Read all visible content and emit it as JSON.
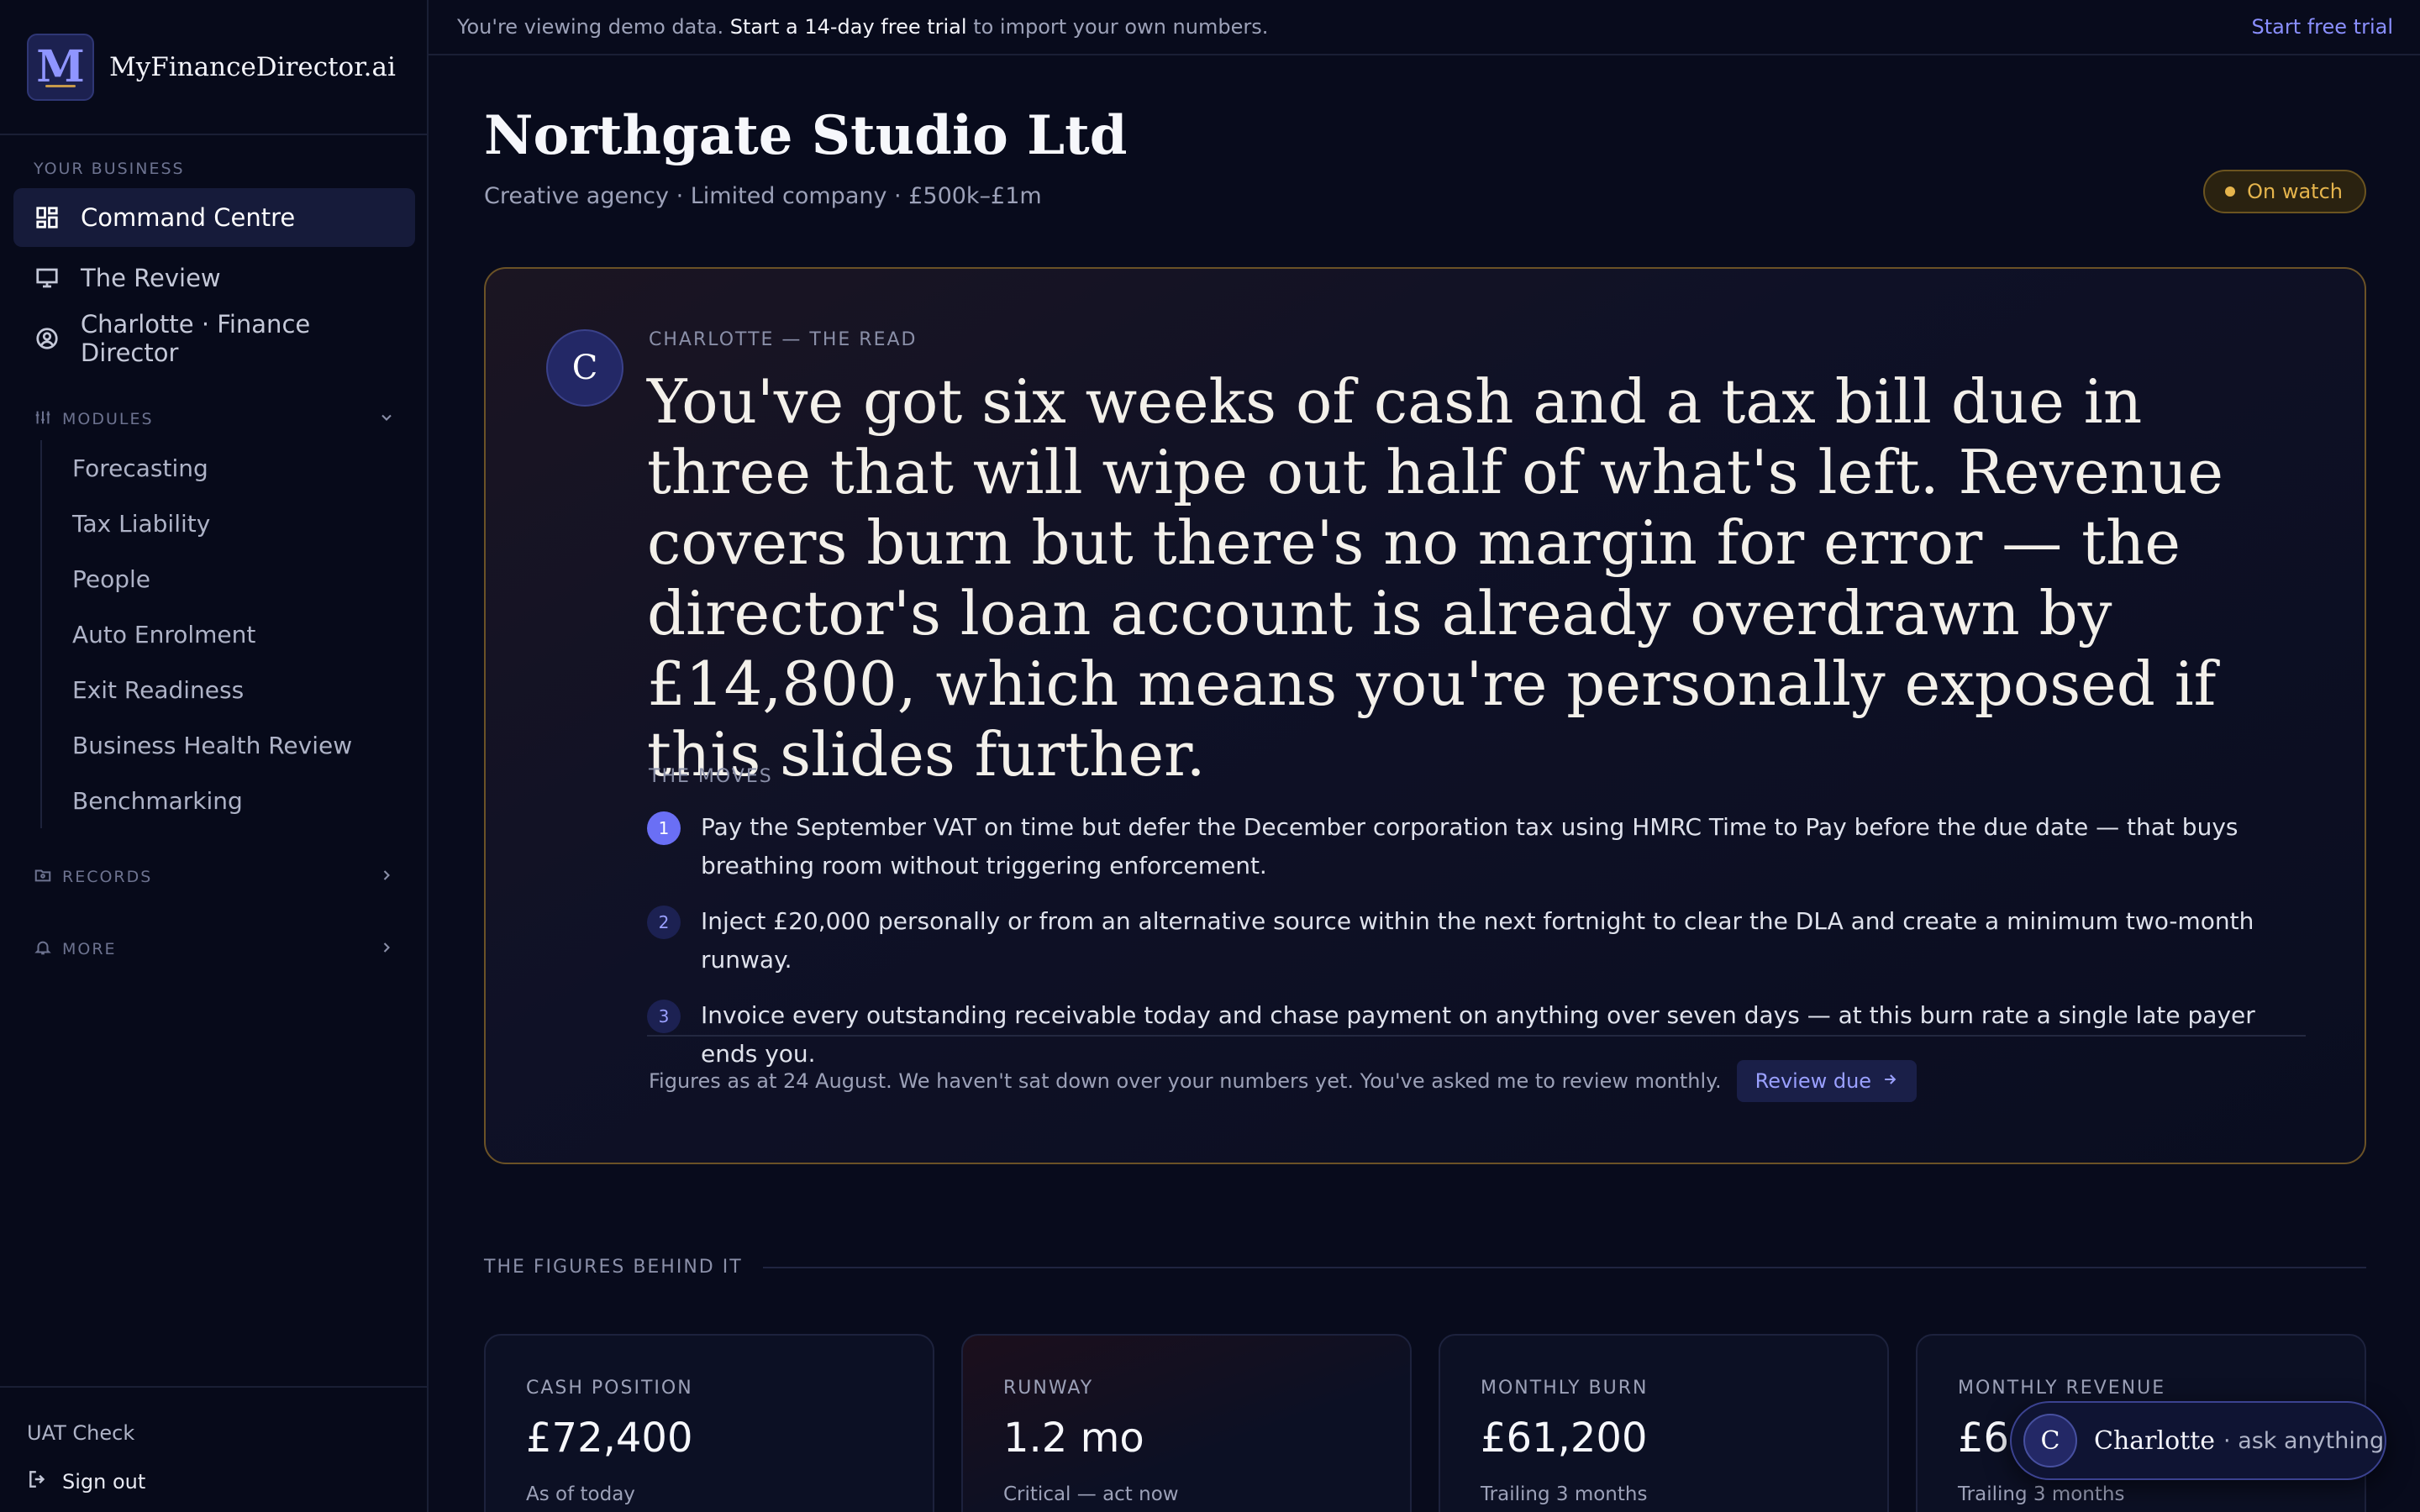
{
  "brand": {
    "logo_letter": "M",
    "name": "MyFinanceDirector.ai"
  },
  "sidebar": {
    "your_business_label": "YOUR BUSINESS",
    "nav": [
      {
        "label": "Command Centre",
        "icon": "grid-icon",
        "active": true
      },
      {
        "label": "The Review",
        "icon": "presentation-icon",
        "active": false
      },
      {
        "label": "Charlotte · Finance Director",
        "icon": "user-circle-icon",
        "active": false
      }
    ],
    "modules_label": "MODULES",
    "modules": [
      "Forecasting",
      "Tax Liability",
      "People",
      "Auto Enrolment",
      "Exit Readiness",
      "Business Health Review",
      "Benchmarking"
    ],
    "records_label": "RECORDS",
    "more_label": "MORE",
    "uat_label": "UAT Check",
    "sign_out_label": "Sign out"
  },
  "banner": {
    "text_before": "You're viewing demo data. ",
    "text_bold": "Start a 14-day free trial",
    "text_after": " to import your own numbers.",
    "cta": "Start free trial"
  },
  "header": {
    "company": "Northgate Studio Ltd",
    "subline": "Creative agency · Limited company · £500k–£1m",
    "status": "On watch"
  },
  "read": {
    "avatar_letter": "C",
    "label": "CHARLOTTE — THE READ",
    "headline": "You've got six weeks of cash and a tax bill due in three that will wipe out half of what's left. Revenue covers burn but there's no margin for error — the director's loan account is already overdrawn by £14,800, which means you're personally exposed if this slides further.",
    "moves_label": "THE MOVES",
    "moves": [
      {
        "num": "1",
        "text": "Pay the September VAT on time but defer the December corporation tax using HMRC Time to Pay before the due date — that buys breathing room without triggering enforcement."
      },
      {
        "num": "2",
        "text": "Inject £20,000 personally or from an alternative source within the next fortnight to clear the DLA and create a minimum two-month runway."
      },
      {
        "num": "3",
        "text": "Invoice every outstanding receivable today and chase payment on anything over seven days — at this burn rate a single late payer ends you."
      }
    ],
    "note": "Figures as at 24 August. We haven't sat down over your numbers yet. You've asked me to review monthly.",
    "review_button": "Review due"
  },
  "figures": {
    "label": "THE FIGURES BEHIND IT",
    "cards": [
      {
        "label": "CASH POSITION",
        "value": "£72,400",
        "sub": "As of today"
      },
      {
        "label": "RUNWAY",
        "value": "1.2 mo",
        "sub": "Critical — act now"
      },
      {
        "label": "MONTHLY BURN",
        "value": "£61,200",
        "sub": "Trailing 3 months"
      },
      {
        "label": "MONTHLY REVENUE",
        "value": "£68",
        "sub": "Trailing 3 months"
      }
    ]
  },
  "chat": {
    "avatar_letter": "C",
    "name": "Charlotte",
    "hint": "· ask anything"
  },
  "colors": {
    "accent": "#8a8fff",
    "warning": "#e5b44c",
    "background": "#080b1c"
  }
}
